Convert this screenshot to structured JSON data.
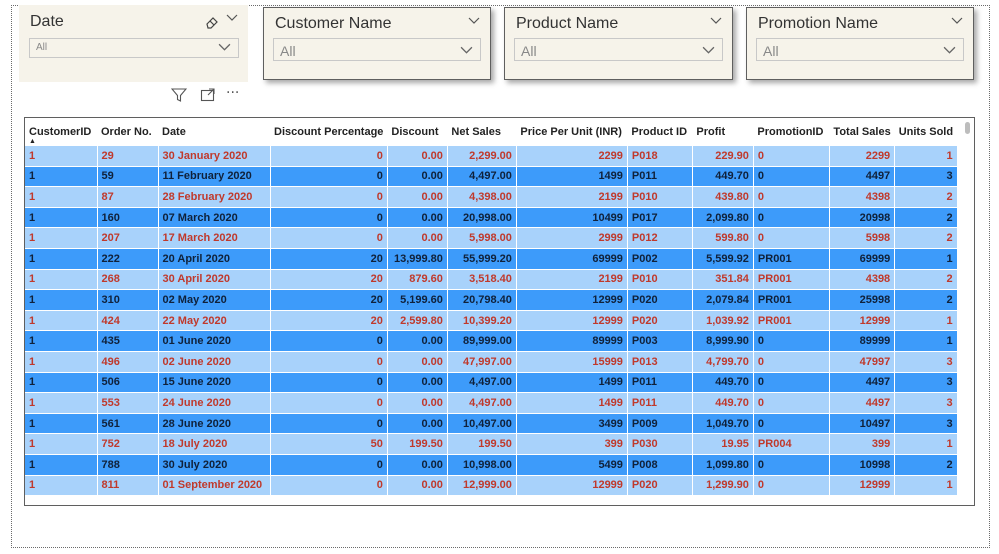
{
  "slicers": {
    "date": {
      "title": "Date",
      "value": "All"
    },
    "customer": {
      "title": "Customer Name",
      "value": "All"
    },
    "product": {
      "title": "Product Name",
      "value": "All"
    },
    "promotion": {
      "title": "Promotion Name",
      "value": "All"
    }
  },
  "hover_tools": {
    "more": "···"
  },
  "table": {
    "columns": [
      "CustomerID",
      "Order No.",
      "Date",
      "Discount Percentage",
      "Discount",
      "Net Sales",
      "Price Per Unit (INR)",
      "Product ID",
      "Profit",
      "PromotionID",
      "Total Sales",
      "Units Sold"
    ],
    "sorted_column": "CustomerID",
    "rows": [
      [
        "1",
        "29",
        "30 January 2020",
        "0",
        "0.00",
        "2,299.00",
        "2299",
        "P018",
        "229.90",
        "0",
        "2299",
        "1"
      ],
      [
        "1",
        "59",
        "11 February 2020",
        "0",
        "0.00",
        "4,497.00",
        "1499",
        "P011",
        "449.70",
        "0",
        "4497",
        "3"
      ],
      [
        "1",
        "87",
        "28 February 2020",
        "0",
        "0.00",
        "4,398.00",
        "2199",
        "P010",
        "439.80",
        "0",
        "4398",
        "2"
      ],
      [
        "1",
        "160",
        "07 March 2020",
        "0",
        "0.00",
        "20,998.00",
        "10499",
        "P017",
        "2,099.80",
        "0",
        "20998",
        "2"
      ],
      [
        "1",
        "207",
        "17 March 2020",
        "0",
        "0.00",
        "5,998.00",
        "2999",
        "P012",
        "599.80",
        "0",
        "5998",
        "2"
      ],
      [
        "1",
        "222",
        "20 April 2020",
        "20",
        "13,999.80",
        "55,999.20",
        "69999",
        "P002",
        "5,599.92",
        "PR001",
        "69999",
        "1"
      ],
      [
        "1",
        "268",
        "30 April 2020",
        "20",
        "879.60",
        "3,518.40",
        "2199",
        "P010",
        "351.84",
        "PR001",
        "4398",
        "2"
      ],
      [
        "1",
        "310",
        "02 May 2020",
        "20",
        "5,199.60",
        "20,798.40",
        "12999",
        "P020",
        "2,079.84",
        "PR001",
        "25998",
        "2"
      ],
      [
        "1",
        "424",
        "22 May 2020",
        "20",
        "2,599.80",
        "10,399.20",
        "12999",
        "P020",
        "1,039.92",
        "PR001",
        "12999",
        "1"
      ],
      [
        "1",
        "435",
        "01 June 2020",
        "0",
        "0.00",
        "89,999.00",
        "89999",
        "P003",
        "8,999.90",
        "0",
        "89999",
        "1"
      ],
      [
        "1",
        "496",
        "02 June 2020",
        "0",
        "0.00",
        "47,997.00",
        "15999",
        "P013",
        "4,799.70",
        "0",
        "47997",
        "3"
      ],
      [
        "1",
        "506",
        "15 June 2020",
        "0",
        "0.00",
        "4,497.00",
        "1499",
        "P011",
        "449.70",
        "0",
        "4497",
        "3"
      ],
      [
        "1",
        "553",
        "24 June 2020",
        "0",
        "0.00",
        "4,497.00",
        "1499",
        "P011",
        "449.70",
        "0",
        "4497",
        "3"
      ],
      [
        "1",
        "561",
        "28 June 2020",
        "0",
        "0.00",
        "10,497.00",
        "3499",
        "P009",
        "1,049.70",
        "0",
        "10497",
        "3"
      ],
      [
        "1",
        "752",
        "18 July 2020",
        "50",
        "199.50",
        "199.50",
        "399",
        "P030",
        "19.95",
        "PR004",
        "399",
        "1"
      ],
      [
        "1",
        "788",
        "30 July 2020",
        "0",
        "0.00",
        "10,998.00",
        "5499",
        "P008",
        "1,099.80",
        "0",
        "10998",
        "2"
      ],
      [
        "1",
        "811",
        "01 September 2020",
        "0",
        "0.00",
        "12,999.00",
        "12999",
        "P020",
        "1,299.90",
        "0",
        "12999",
        "1"
      ]
    ]
  },
  "colors": {
    "row_light": "#a8d2fb",
    "row_dark": "#3d9bfa",
    "text_light_row": "#c0392b",
    "text_dark_row": "#10213a"
  }
}
